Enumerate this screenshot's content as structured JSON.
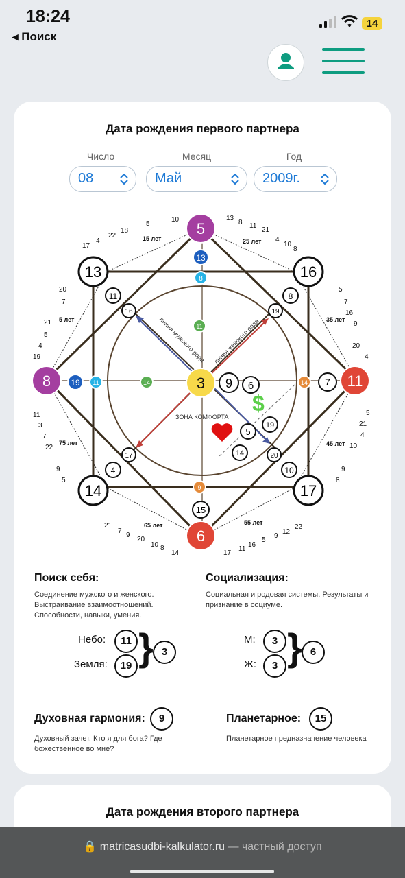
{
  "status": {
    "time": "18:24",
    "back": "◂ Поиск",
    "battery": "14"
  },
  "card1": {
    "title": "Дата рождения первого партнера",
    "labels": {
      "day": "Число",
      "month": "Месяц",
      "year": "Год"
    },
    "values": {
      "day": "08",
      "month": "Май",
      "year": "2009г."
    }
  },
  "matrix": {
    "top": "5",
    "left": "8",
    "right": "11",
    "bottom": "6",
    "center": "3",
    "tl": "13",
    "tr": "16",
    "bl": "14",
    "br": "17",
    "top2": "13",
    "top3": "8",
    "left2": "19",
    "left3": "11",
    "right2": "7",
    "right3": "14",
    "bottom2": "15",
    "bottom3": "9",
    "inner_top": "11",
    "inner_left": "14",
    "c_r1": "9",
    "c_r2": "6",
    "c_money": "19",
    "c_heart5": "5",
    "c_14": "14",
    "sq_tl": "11",
    "sq_tl2": "16",
    "sq_tr": "8",
    "sq_tr2": "19",
    "sq_bl": "4",
    "sq_bl2": "17",
    "sq_br": "10",
    "sq_br2": "20",
    "male_line": "линия мужского рода",
    "female_line": "линия женского рода",
    "comfort": "ЗОНА КОМФОРТА",
    "ages": [
      "5 лет",
      "15 лет",
      "25 лет",
      "35 лет",
      "45 лет",
      "55 лет",
      "65 лет",
      "75 лет"
    ],
    "arc_tl": [
      "17",
      "4",
      "22",
      "18",
      "5",
      "10"
    ],
    "arc_tl_left": [
      "20",
      "7",
      "21",
      "5",
      "4",
      "19"
    ],
    "arc_tr": [
      "13",
      "8",
      "11",
      "21",
      "4",
      "10",
      "8"
    ],
    "arc_tr_right": [
      "5",
      "7",
      "16",
      "9",
      "20",
      "4"
    ],
    "arc_bl": [
      "21",
      "7",
      "9",
      "20",
      "10",
      "8",
      "14"
    ],
    "arc_bl_left": [
      "11",
      "3",
      "7",
      "22",
      "9",
      "5"
    ],
    "arc_br": [
      "17",
      "11",
      "16",
      "5",
      "9",
      "12",
      "22"
    ],
    "arc_br_right": [
      "5",
      "21",
      "4",
      "10",
      "9",
      "8"
    ]
  },
  "self": {
    "title": "Поиск себя:",
    "text": "Соединение мужского и женского. Выстраивание взаимоотношений. Способности, навыки, умения.",
    "sky_label": "Небо:",
    "sky": "11",
    "earth_label": "Земля:",
    "earth": "19",
    "sum": "3"
  },
  "social": {
    "title": "Социализация:",
    "text": "Социальная и родовая системы. Результаты и признание в социуме.",
    "m_label": "М:",
    "m": "3",
    "f_label": "Ж:",
    "f": "3",
    "sum": "6"
  },
  "spirit": {
    "title": "Духовная гармония:",
    "value": "9",
    "text": "Духовный зачет. Кто я для бога? Где божественное во мне?"
  },
  "planet": {
    "title": "Планетарное:",
    "value": "15",
    "text": "Планетарное предназначение человека"
  },
  "card2": {
    "title": "Дата рождения второго партнера"
  },
  "browser": {
    "domain": "matricasudbi-kalkulator.ru",
    "suffix": " — частный доступ"
  }
}
